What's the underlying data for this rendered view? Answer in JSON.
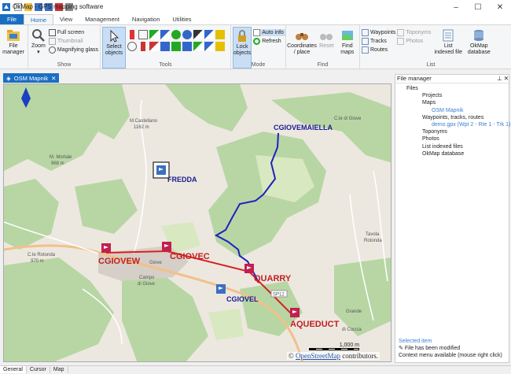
{
  "window": {
    "title": "OkMap - GPS mapping software"
  },
  "menu_tabs": [
    "File",
    "Home",
    "View",
    "Management",
    "Navigation",
    "Utilities"
  ],
  "ribbon": {
    "file_manager": "File\nmanager",
    "show": {
      "zoom": "Zoom",
      "full_screen": "Full screen",
      "thumbnail": "Thumbnail",
      "magnifying": "Magnifying glass",
      "label": "Show"
    },
    "tools": {
      "select": "Select\nobjects",
      "label": "Tools"
    },
    "mode": {
      "lock": "Lock\nobjects",
      "auto_info": "Auto info",
      "refresh": "Refresh",
      "label": "Mode"
    },
    "find": {
      "coords": "Coordinates\n/ place",
      "reset": "Reset",
      "find_maps": "Find\nmaps",
      "label": "Find"
    },
    "list": {
      "waypoints": "Waypoints",
      "tracks": "Tracks",
      "routes": "Routes",
      "toponyms": "Toponyms",
      "photos": "Photos",
      "indexed": "List\nindexed file",
      "db": "OkMap\ndatabase",
      "label": "List"
    }
  },
  "doc_tab": "OSM Mapnik",
  "map": {
    "labels": {
      "cgiovemaiella": "CGIOVEMAIELLA",
      "fredda": "FREDDA",
      "quarry": "QUARRY",
      "cgiovel": "CGIOVEL",
      "cgiovew": "CGIOVEW",
      "cgiovec": "CGIOVEC",
      "aqueduct": "AQUEDUCT"
    },
    "place_labels": {
      "castellano": "M.Castellano",
      "castellano_elev": "1162 m",
      "mortale": "M. Mortale",
      "mortale_elev": "968 m",
      "cle_rotonda": "C.le Rotonda",
      "cle_rotonda_elev": "970 m",
      "giove": "Giove",
      "campo": "Campo",
      "campo2": "di Giove",
      "tavola": "Tavola",
      "rotonda": "Rotonda",
      "sp12": "SP12",
      "cle_giove": "C.le di Giove",
      "grande": "Grande",
      "coccia": "di Coccia"
    },
    "scale": "1,000 m",
    "attribution_prefix": "©",
    "attribution_link": "OpenStreetMap",
    "attribution_suffix": "contributors."
  },
  "file_manager": {
    "title": "File manager",
    "tree": [
      "Files",
      "Projects",
      "Maps",
      "OSM Mapnik",
      "Waypoints, tracks, routes",
      "demo.gpx (Wpt 2 - Rte 1 - Trk 1)",
      "Toponyms",
      "Photos",
      "List indexed files",
      "OkMap database"
    ],
    "selected_item": "Selected item",
    "modified": "File has been modified",
    "context": "Context menu available (mouse right click)"
  },
  "status_tabs": [
    "General",
    "Cursor",
    "Map"
  ]
}
